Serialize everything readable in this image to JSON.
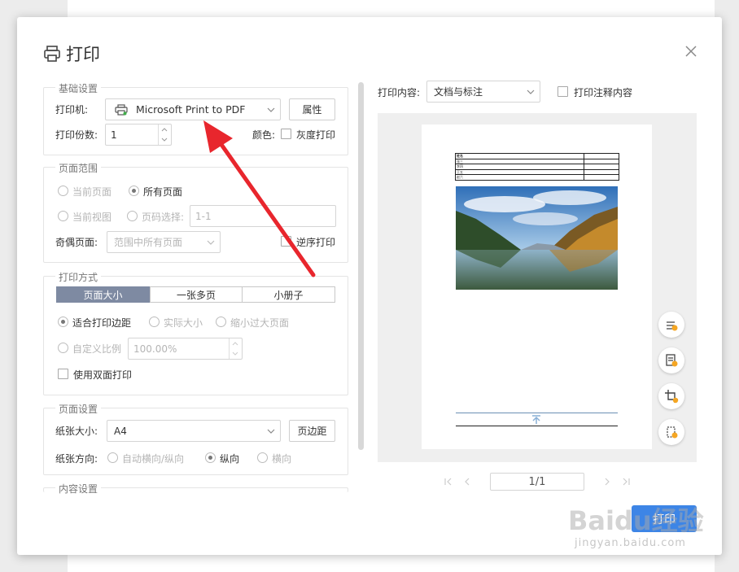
{
  "dialog": {
    "title": "打印"
  },
  "basic": {
    "legend": "基础设置",
    "printer_label": "打印机:",
    "printer_value": "Microsoft Print to PDF",
    "properties_button": "属性",
    "copies_label": "打印份数:",
    "copies_value": "1",
    "color_label": "颜色:",
    "grayscale_label": "灰度打印"
  },
  "range": {
    "legend": "页面范围",
    "current_page": "当前页面",
    "all_pages": "所有页面",
    "current_view": "当前视图",
    "page_select": "页码选择:",
    "page_select_placeholder": "1-1",
    "odd_even_label": "奇偶页面:",
    "odd_even_value": "范围中所有页面",
    "reverse_label": "逆序打印"
  },
  "mode": {
    "legend": "打印方式",
    "tabs": [
      "页面大小",
      "一张多页",
      "小册子"
    ],
    "fit_margin": "适合打印边距",
    "actual_size": "实际大小",
    "shrink_large": "缩小过大页面",
    "custom_scale": "自定义比例",
    "custom_scale_value": "100.00%",
    "duplex_label": "使用双面打印"
  },
  "page_setup": {
    "legend": "页面设置",
    "paper_size_label": "纸张大小:",
    "paper_size_value": "A4",
    "margins_button": "页边距",
    "orientation_label": "纸张方向:",
    "auto_orientation": "自动横向/纵向",
    "portrait": "纵向",
    "landscape": "横向"
  },
  "content": {
    "legend": "内容设置"
  },
  "preview": {
    "content_label": "打印内容:",
    "content_value": "文档与标注",
    "print_annotation_label": "打印注释内容",
    "page_indicator": "1/1",
    "table_rows": [
      [
        "姓名",
        ""
      ],
      [
        "张三",
        ""
      ],
      [
        "李四",
        ""
      ],
      [
        "王五",
        ""
      ],
      [
        "赵六",
        ""
      ]
    ]
  },
  "footer": {
    "ok_button": "打印"
  },
  "watermark": {
    "brand": "Baidu经验",
    "url": "jingyan.baidu.com"
  },
  "colors": {
    "accent": "#3d85e6",
    "arrow": "#e8262d",
    "active_tab": "#7e8aa2"
  }
}
